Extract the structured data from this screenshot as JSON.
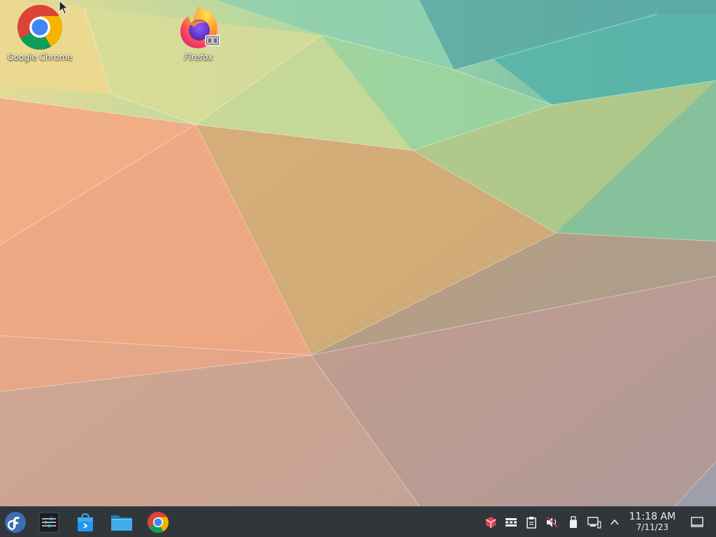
{
  "desktop": {
    "icons": [
      {
        "label": "Google Chrome",
        "icon": "chrome-icon"
      },
      {
        "label": "Firefox",
        "icon": "firefox-icon"
      }
    ]
  },
  "panel": {
    "launchers": [
      {
        "name": "application-launcher",
        "icon": "fedora-icon"
      },
      {
        "name": "system-settings",
        "icon": "settings-sliders-icon"
      },
      {
        "name": "discover-software-center",
        "icon": "shopping-bag-icon"
      },
      {
        "name": "file-manager",
        "icon": "folder-icon"
      },
      {
        "name": "google-chrome",
        "icon": "chrome-icon"
      }
    ],
    "tray": [
      {
        "name": "package-updates",
        "icon": "cube-icon"
      },
      {
        "name": "virtual-keyboard",
        "icon": "keyboard-icon"
      },
      {
        "name": "clipboard",
        "icon": "clipboard-icon"
      },
      {
        "name": "volume-muted",
        "icon": "speaker-muted-icon"
      },
      {
        "name": "removable-devices",
        "icon": "usb-drive-icon"
      },
      {
        "name": "network",
        "icon": "wired-network-icon"
      },
      {
        "name": "show-hidden-icons",
        "icon": "chevron-up-icon"
      }
    ],
    "clock": {
      "time": "11:18 AM",
      "date": "7/11/23"
    }
  },
  "colors": {
    "panel_bg": "#31363b",
    "panel_fg": "#eff0f1"
  }
}
